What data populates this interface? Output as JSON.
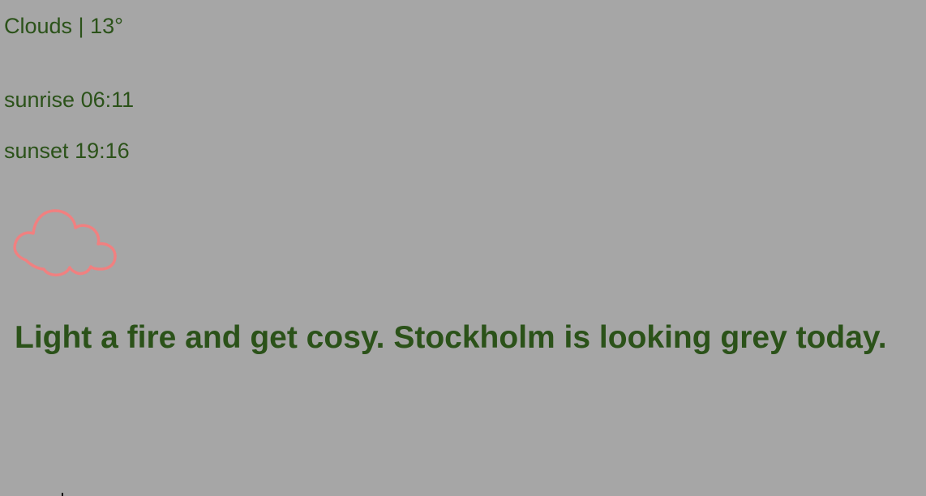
{
  "weather": {
    "condition": "Clouds",
    "separator": " | ",
    "temperature": "13°",
    "sunrise_label": "sunrise",
    "sunrise_time": "06:11",
    "sunset_label": "sunset",
    "sunset_time": "19:16",
    "icon": "cloud-icon",
    "message": "Light a fire and get cosy. Stockholm is looking grey today."
  },
  "colors": {
    "background": "#a6a6a6",
    "text": "#2b5219",
    "icon_stroke": "#f08080"
  }
}
